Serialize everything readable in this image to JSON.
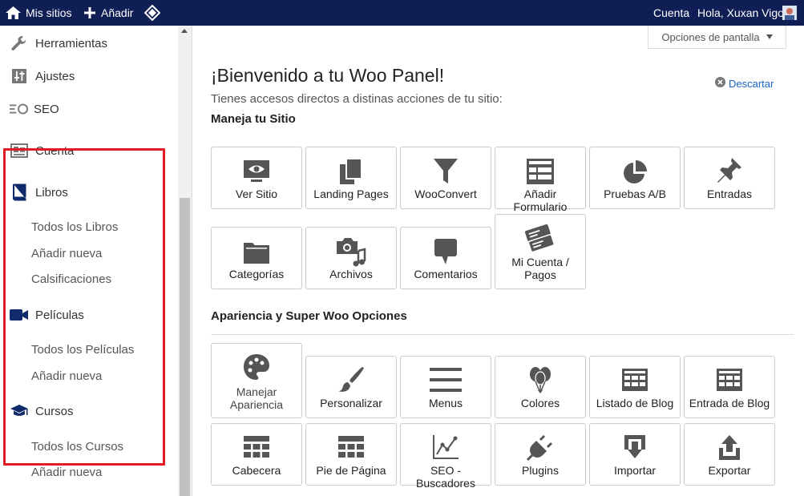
{
  "topbar": {
    "sites_label": "Mis sitios",
    "add_label": "Añadir",
    "account_label": "Cuenta",
    "greeting": "Hola, Xuxan Vigo"
  },
  "sidebar": {
    "items": [
      {
        "label": "Herramientas",
        "icon": "wrench-icon"
      },
      {
        "label": "Ajustes",
        "icon": "settings-icon"
      },
      {
        "label": "SEO",
        "icon": "seo-icon"
      },
      {
        "label": "Cuenta",
        "icon": "id-card-icon"
      },
      {
        "label": "Libros",
        "icon": "book-icon"
      },
      {
        "label": "Películas",
        "icon": "video-camera-icon"
      },
      {
        "label": "Cursos",
        "icon": "graduation-cap-icon"
      }
    ],
    "libros_sub": [
      "Todos los Libros",
      "Añadir nueva",
      "Calsificaciones"
    ],
    "peliculas_sub": [
      "Todos los Películas",
      "Añadir nueva"
    ],
    "cursos_sub": [
      "Todos los Cursos",
      "Añadir nueva"
    ]
  },
  "main": {
    "screen_options": "Opciones de pantalla",
    "title": "¡Bienvenido a tu Woo Panel!",
    "subtitle": "Tienes accesos directos a distinas acciones de tu sitio:",
    "dismiss": "Descartar",
    "section1_title": "Maneja tu Sitio",
    "section2_title": "Apariencia y Super Woo Opciones",
    "tiles1": [
      {
        "label": "Ver Sitio",
        "icon": "monitor-eye-icon"
      },
      {
        "label": "Landing Pages",
        "icon": "copy-pages-icon"
      },
      {
        "label": "WooConvert",
        "icon": "funnel-icon"
      },
      {
        "label": "Añadir Formulario",
        "icon": "form-icon"
      },
      {
        "label": "Pruebas A/B",
        "icon": "pie-chart-icon"
      },
      {
        "label": "Entradas",
        "icon": "pushpin-icon"
      },
      {
        "label": "Categorías",
        "icon": "folder-icon"
      },
      {
        "label": "Archivos",
        "icon": "media-icon"
      },
      {
        "label": "Comentarios",
        "icon": "comment-icon"
      },
      {
        "label": "Mi Cuenta / Pagos",
        "icon": "tickets-icon"
      }
    ],
    "tiles2": [
      {
        "label": "Manejar Apariencia",
        "icon": "palette-icon"
      },
      {
        "label": "Personalizar",
        "icon": "brush-icon"
      },
      {
        "label": "Menus",
        "icon": "menu-lines-icon"
      },
      {
        "label": "Colores",
        "icon": "balloons-icon"
      },
      {
        "label": "Listado de Blog",
        "icon": "calendar-grid-icon"
      },
      {
        "label": "Entrada de Blog",
        "icon": "calendar-grid-icon"
      },
      {
        "label": "Cabecera",
        "icon": "header-grid-icon"
      },
      {
        "label": "Pie de Página",
        "icon": "footer-grid-icon"
      },
      {
        "label": "SEO - Buscadores",
        "icon": "line-chart-icon"
      },
      {
        "label": "Plugins",
        "icon": "plug-icon"
      },
      {
        "label": "Importar",
        "icon": "import-icon"
      },
      {
        "label": "Exportar",
        "icon": "export-icon"
      }
    ]
  },
  "colors": {
    "topbar_bg": "#0f1f56",
    "icon_gray": "#555555",
    "highlight_border": "#e31b23",
    "link": "#1a64c8"
  }
}
